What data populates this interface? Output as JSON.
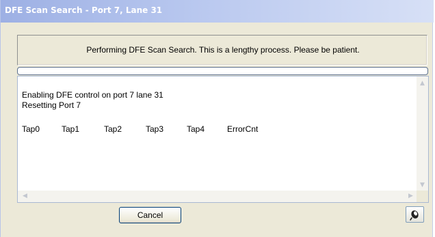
{
  "window": {
    "title": "DFE Scan Search - Port 7, Lane 31"
  },
  "message": {
    "text": "Performing DFE Scan Search.  This is a lengthy process. Please be patient."
  },
  "progress": {
    "percent": 0
  },
  "log": {
    "lines": [
      "Enabling DFE control on port 7 lane 31",
      "Resetting Port 7"
    ],
    "columns": [
      "Tap0",
      "Tap1",
      "Tap2",
      "Tap3",
      "Tap4",
      "ErrorCnt"
    ]
  },
  "buttons": {
    "cancel_label": "Cancel",
    "clear_icon": "eraser-icon"
  },
  "colors": {
    "titlebar": "#9db0e4",
    "dialog_bg": "#ece9d8",
    "button_border": "#003c74"
  }
}
